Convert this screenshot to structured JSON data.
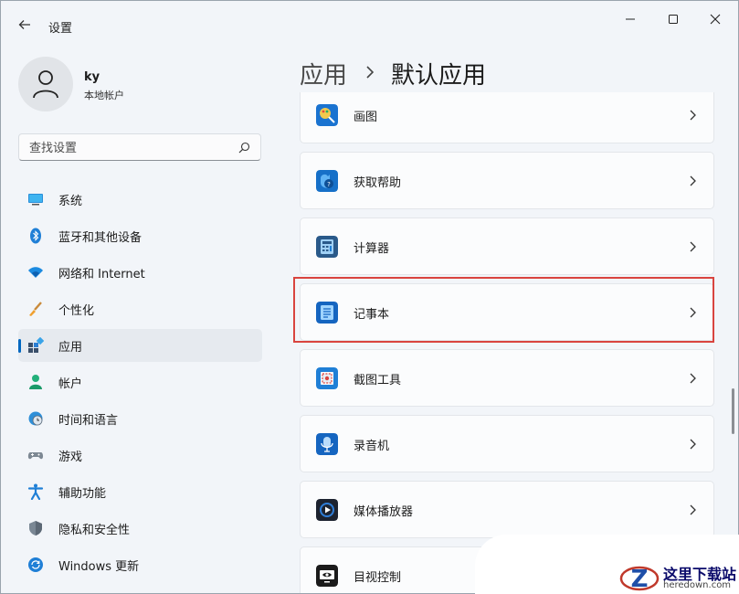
{
  "window": {
    "title": "设置"
  },
  "account": {
    "name": "ky",
    "type": "本地帐户"
  },
  "search": {
    "placeholder": "查找设置"
  },
  "sidebar": {
    "items": [
      {
        "label": "系统",
        "icon": "monitor-icon"
      },
      {
        "label": "蓝牙和其他设备",
        "icon": "bluetooth-icon"
      },
      {
        "label": "网络和 Internet",
        "icon": "wifi-icon"
      },
      {
        "label": "个性化",
        "icon": "brush-icon"
      },
      {
        "label": "应用",
        "icon": "apps-icon",
        "active": true
      },
      {
        "label": "帐户",
        "icon": "person-icon"
      },
      {
        "label": "时间和语言",
        "icon": "globe-clock-icon"
      },
      {
        "label": "游戏",
        "icon": "gamepad-icon"
      },
      {
        "label": "辅助功能",
        "icon": "accessibility-icon"
      },
      {
        "label": "隐私和安全性",
        "icon": "shield-icon"
      },
      {
        "label": "Windows 更新",
        "icon": "update-icon"
      }
    ]
  },
  "breadcrumb": {
    "parent": "应用",
    "current": "默认应用"
  },
  "apps": [
    {
      "name": "画图",
      "icon": "paint-icon"
    },
    {
      "name": "获取帮助",
      "icon": "help-icon"
    },
    {
      "name": "计算器",
      "icon": "calculator-icon"
    },
    {
      "name": "记事本",
      "icon": "notepad-icon",
      "highlighted": true
    },
    {
      "name": "截图工具",
      "icon": "snipping-tool-icon"
    },
    {
      "name": "录音机",
      "icon": "recorder-icon"
    },
    {
      "name": "媒体播放器",
      "icon": "media-player-icon"
    },
    {
      "name": "目视控制",
      "icon": "eye-control-icon"
    }
  ],
  "watermark": {
    "text": "这里下载站",
    "sub": "heredown.com"
  },
  "colors": {
    "accent": "#0067c0",
    "highlight_border": "#d9443f"
  }
}
